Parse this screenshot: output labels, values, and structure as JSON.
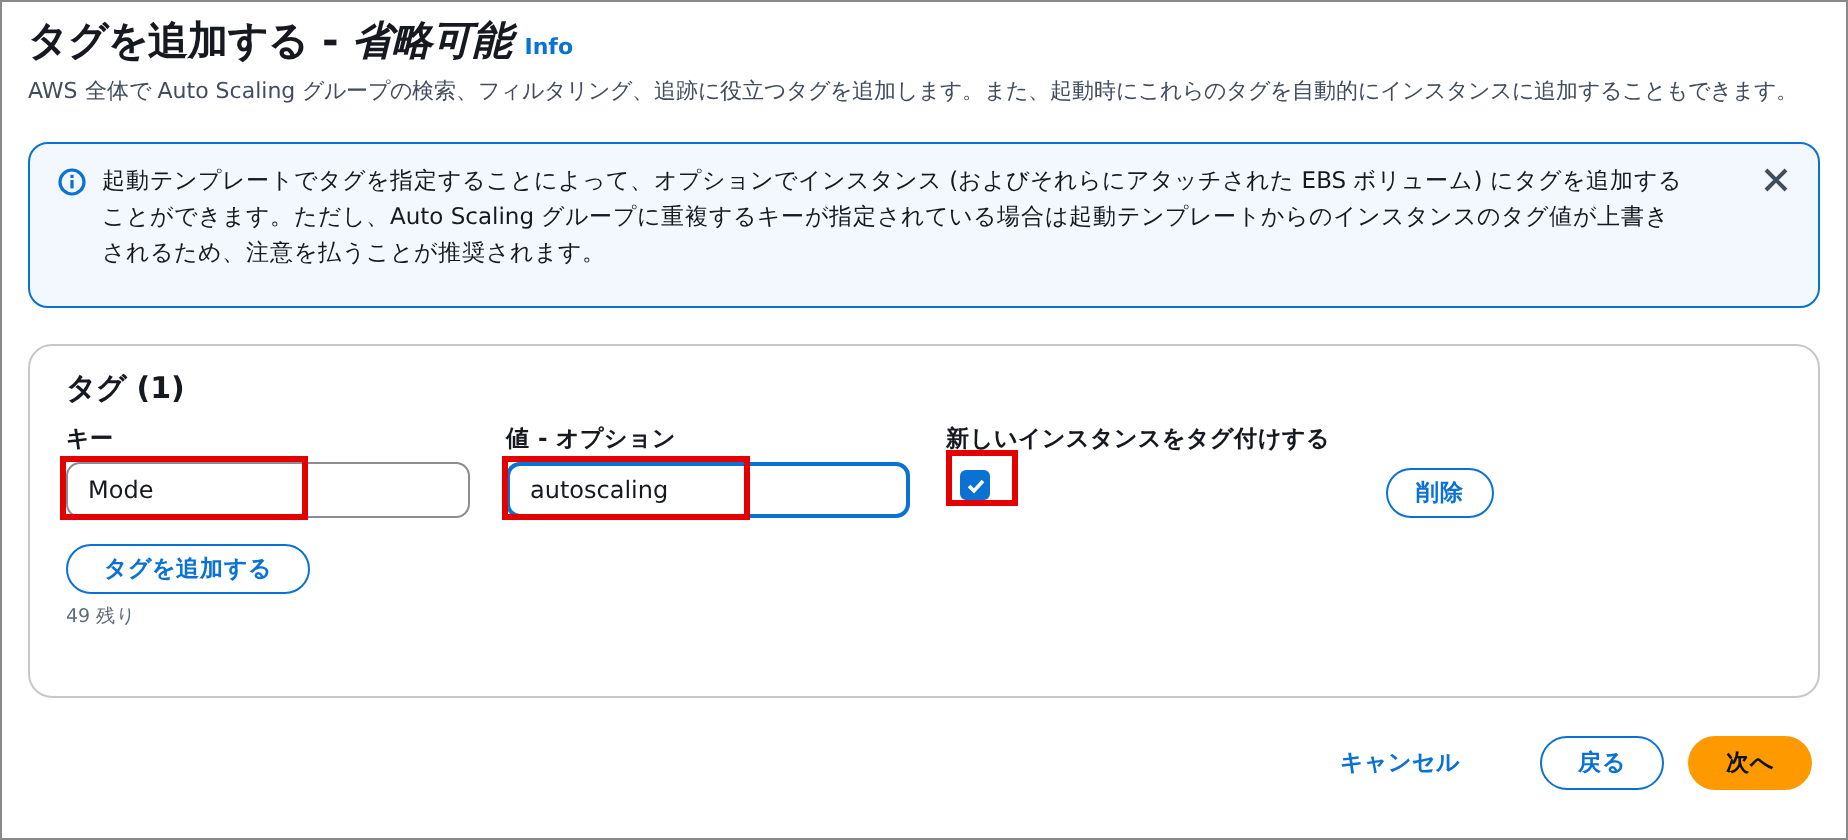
{
  "header": {
    "title": "タグを追加する - *省略可能*",
    "info_link": "Info",
    "description": "AWS 全体で Auto Scaling グループの検索、フィルタリング、追跡に役立つタグを追加します。また、起動時にこれらのタグを自動的にインスタンスに追加することもできます。"
  },
  "alert": {
    "text": "起動テンプレートでタグを指定することによって、オプションでインスタンス (およびそれらにアタッチされた EBS ボリューム) にタグを追加することができます。ただし、Auto Scaling グループに重複するキーが指定されている場合は起動テンプレートからのインスタンスのタグ値が上書きされるため、注意を払うことが推奨されます。"
  },
  "tags_panel": {
    "title": "タグ (1)",
    "columns": [
      "キー",
      "値 - オプション",
      "新しいインスタンスをタグ付けする"
    ],
    "rows": [
      {
        "key": "Mode",
        "value": "autoscaling",
        "value_focused": true,
        "tag_new_instances": true,
        "remove_label": "削除",
        "key_highlighted": true,
        "value_highlighted": true,
        "checkbox_highlighted": true
      }
    ],
    "add_button": "タグを追加する",
    "remaining": "49 残り"
  },
  "footer": {
    "buttons": [
      {
        "label": "キャンセル",
        "kind": "link"
      },
      {
        "label": "戻る",
        "kind": "secondary"
      },
      {
        "label": "次へ",
        "kind": "primary"
      }
    ]
  }
}
